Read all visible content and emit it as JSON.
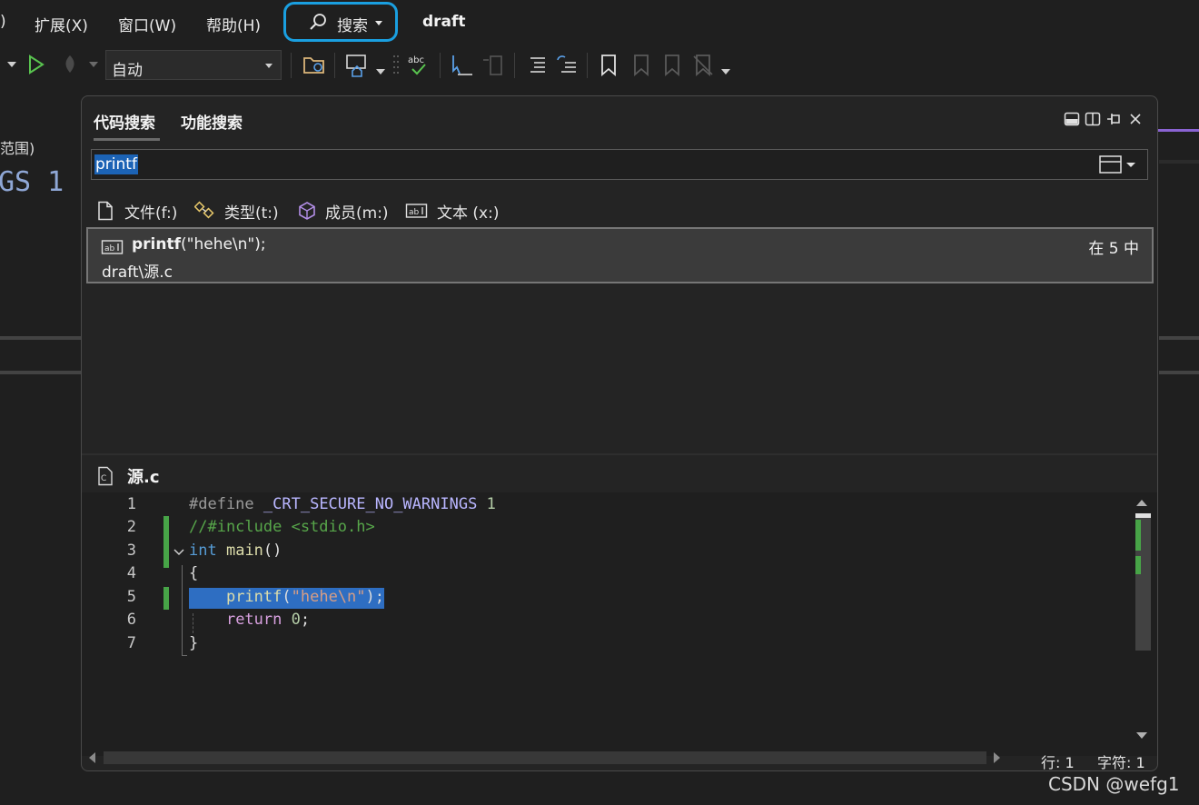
{
  "menu": {
    "partial_left": ")",
    "items": [
      "扩展(X)",
      "窗口(W)",
      "帮助(H)"
    ],
    "search_label": "搜索",
    "solution_title": "draft"
  },
  "toolbar": {
    "config_value": "自动"
  },
  "background": {
    "scope_label": "范围)",
    "code_fragment": "GS 1",
    "accent_color": "#8a63d2"
  },
  "search_panel": {
    "tabs": [
      "代码搜索",
      "功能搜索"
    ],
    "active_tab": "代码搜索",
    "query": "printf",
    "filters": [
      {
        "label": "文件(f:)",
        "icon": "file-icon"
      },
      {
        "label": "类型(t:)",
        "icon": "type-icon"
      },
      {
        "label": "成员(m:)",
        "icon": "member-icon"
      },
      {
        "label": "文本 (x:)",
        "icon": "text-icon"
      }
    ],
    "result": {
      "match": "printf",
      "rest": "(\"hehe\\n\");",
      "path": "draft\\源.c",
      "location": "在 5 中"
    },
    "preview": {
      "file_name": "源.c",
      "lines": [
        "1",
        "2",
        "3",
        "4",
        "5",
        "6",
        "7"
      ],
      "selected_line": 5
    },
    "status": {
      "line": "行: 1",
      "char": "字符: 1"
    }
  },
  "watermark": "CSDN @wefg1",
  "colors": {
    "selection": "#2e6ec2",
    "change_marker": "#47a447",
    "focus_ring": "#1a9fe0"
  }
}
